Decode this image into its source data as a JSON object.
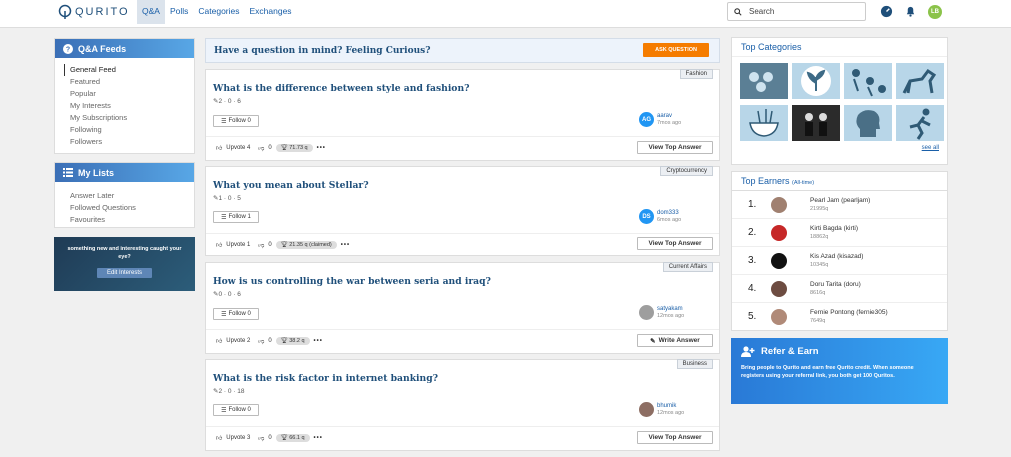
{
  "header": {
    "brand": "QURITO",
    "nav": [
      "Q&A",
      "Polls",
      "Categories",
      "Exchanges"
    ],
    "search_placeholder": "Search",
    "avatar_initials": "LB"
  },
  "left": {
    "feeds_title": "Q&A Feeds",
    "feeds": [
      "General Feed",
      "Featured",
      "Popular",
      "My Interests",
      "My Subscriptions",
      "Following",
      "Followers"
    ],
    "lists_title": "My Lists",
    "lists": [
      "Answer Later",
      "Followed Questions",
      "Favourites"
    ],
    "promo_text": "something new and interesting caught your eye?",
    "promo_button": "Edit Interests"
  },
  "ask": {
    "question": "Have a question in mind? Feeling Curious?",
    "button": "ASK QUESTION"
  },
  "questions": [
    {
      "category": "Fashion",
      "title": "What is the difference between style and fashion?",
      "meta": "2 · 0 · 6",
      "follow": "Follow 0",
      "user": "aarav",
      "user_initials": "AG",
      "time": "7mos ago",
      "upvotes": "Upvote 4",
      "downvotes": "0",
      "reward": "71.73 q",
      "action": "View Top Answer"
    },
    {
      "category": "Cryptocurrency",
      "title": "What you mean about Stellar?",
      "meta": "1 · 0 · 5",
      "follow": "Follow 1",
      "user": "dom333",
      "user_initials": "DS",
      "time": "6mos ago",
      "upvotes": "Upvote 1",
      "downvotes": "0",
      "reward": "21.35 q (claimed)",
      "action": "View Top Answer"
    },
    {
      "category": "Current Affairs",
      "title": "How is us controlling the war between seria and iraq?",
      "meta": "0 · 0 · 6",
      "follow": "Follow 0",
      "user": "satyakam",
      "user_initials": "",
      "time": "12mos ago",
      "upvotes": "Upvote 2",
      "downvotes": "0",
      "reward": "38.2 q",
      "action": "Write Answer"
    },
    {
      "category": "Business",
      "title": "What is the risk factor in internet banking?",
      "meta": "2 · 0 · 18",
      "follow": "Follow 0",
      "user": "bhumik",
      "user_initials": "",
      "time": "12mos ago",
      "upvotes": "Upvote 3",
      "downvotes": "0",
      "reward": "66.1 q",
      "action": "View Top Answer"
    }
  ],
  "right": {
    "categories_title": "Top Categories",
    "see_all": "see all",
    "earners_title": "Top Earners",
    "earners_sub": "(All-time)",
    "earners": [
      {
        "rank": "1.",
        "name": "Pearl Jam (pearljam)",
        "score": "21995q"
      },
      {
        "rank": "2.",
        "name": "Kirti Bagda (kirti)",
        "score": "18862q"
      },
      {
        "rank": "3.",
        "name": "Kis Azad (kisazad)",
        "score": "10345q"
      },
      {
        "rank": "4.",
        "name": "Doru Tarita (doru)",
        "score": "8616q"
      },
      {
        "rank": "5.",
        "name": "Fernie Pontong (fernie305)",
        "score": "7649q"
      }
    ],
    "refer_title": "Refer & Earn",
    "refer_text": "Bring people to Qurito and earn free Qurito credit. When someone registers using your referral link, you both get 100 Quritos."
  },
  "colors": {
    "brand_blue": "#1f4f7a",
    "accent": "#1a5fa8",
    "ask_button": "#f57c00",
    "refer_bg": "#2979d6"
  }
}
